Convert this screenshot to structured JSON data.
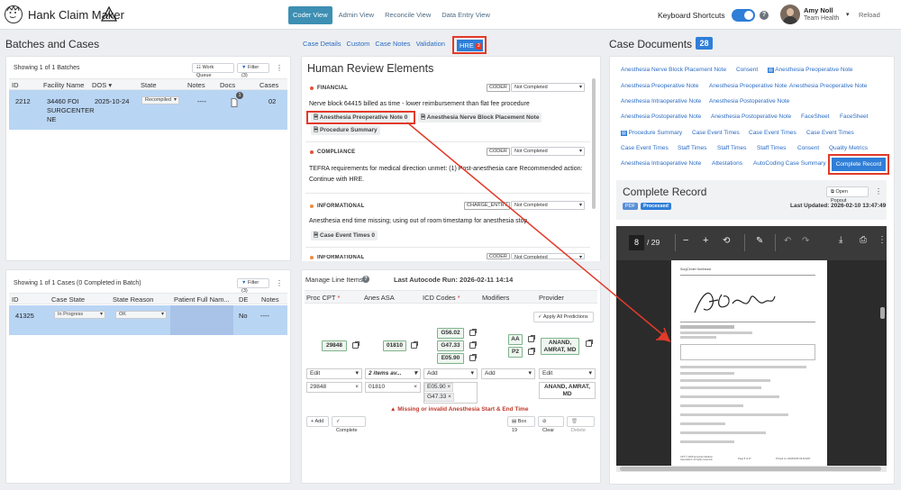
{
  "app": {
    "title": "Hank Claim Maker",
    "nav": [
      "Coder View",
      "Admin View",
      "Reconcile View",
      "Data Entry View"
    ],
    "active_nav": "Coder View"
  },
  "header": {
    "keyboard_shortcuts": "Keyboard Shortcuts",
    "user_name": "Amy Noll",
    "user_org": "Team Health",
    "reload": "Reload"
  },
  "batches": {
    "title": "Batches and Cases",
    "showing": "Showing 1 of 1 Batches",
    "work_queue": "Work Queue",
    "filter": "Filter (3)",
    "columns": [
      "ID",
      "Facility Name",
      "DOS",
      "State",
      "Notes",
      "Docs",
      "Cases"
    ],
    "row": {
      "id": "2212",
      "facility_line1": "34460 FOI",
      "facility_line2": "SURGCENTER",
      "facility_line3": "NE",
      "dos": "2025-10-24",
      "state": "Recompiled",
      "notes": "----",
      "docs_badge": "1",
      "cases": "02"
    }
  },
  "cases": {
    "showing": "Showing 1 of 1 Cases (0 Completed in Batch)",
    "filter": "Filter (3)",
    "columns": [
      "ID",
      "Case State",
      "State Reason",
      "Patient Full Nam...",
      "DE",
      "Notes"
    ],
    "row": {
      "id": "41325",
      "case_state": "In Progress",
      "state_reason": "OK",
      "de": "No",
      "notes": "----"
    }
  },
  "case_tabs": {
    "items": [
      "Case Details",
      "Custom",
      "Case Notes",
      "Validation"
    ],
    "hre": "HRE",
    "hre_count": "2"
  },
  "hre": {
    "title": "Human Review Elements",
    "sections": [
      {
        "label": "FINANCIAL",
        "role": "CODER",
        "status": "Not Completed",
        "text": "Nerve block 64415 billed as time - lower reimbursement than flat fee procedure",
        "chips": [
          "Anesthesia Preoperative Note 0",
          "Anesthesia Nerve Block Placement Note",
          "Procedure Summary"
        ]
      },
      {
        "label": "COMPLIANCE",
        "role": "CODER",
        "status": "Not Completed",
        "text": "TEFRA requirements for medical direction unmet: (1) Post-anesthesia care Recommended action: Continue with HRE."
      },
      {
        "label": "INFORMATIONAL",
        "role": "CHARGE_ENTRY",
        "status": "Not Completed",
        "text": "Anesthesia end time missing; using out of room timestamp for anesthesia stop.",
        "chips": [
          "Case Event Times 0"
        ]
      },
      {
        "label": "INFORMATIONAL",
        "role": "CODER",
        "status": "Not Completed"
      }
    ],
    "colors": {
      "financial": "#e0533a",
      "compliance": "#e0533a",
      "informational": "#f08a3c"
    }
  },
  "line_items": {
    "title": "Manage Line Items",
    "last_run": "Last Autocode Run: 2026-02-11 14:14",
    "columns": [
      "Proc CPT",
      "Anes ASA",
      "ICD Codes",
      "Modifiers",
      "Provider"
    ],
    "apply": "Apply All Predictions",
    "pred": {
      "cpt": "29848",
      "asa": "01810",
      "icd": [
        "G56.02",
        "G47.33",
        "E05.90"
      ],
      "mods": [
        "AA",
        "P2"
      ],
      "provider": "ANAND, AMRAT, MD"
    },
    "edit_row": {
      "cpt": "Edit",
      "asa": "2 items av...",
      "icd": "Add",
      "mod": "Add",
      "prov": "Edit"
    },
    "values": {
      "cpt": "29848",
      "asa": "01810",
      "icd": [
        "E05.90",
        "G47.33"
      ],
      "provider": "ANAND, AMRAT, MD"
    },
    "warning": "Missing or invalid Anesthesia Start & End Time",
    "buttons": {
      "add": "Add",
      "complete": "Complete",
      "box": "Box 19",
      "clear": "Clear",
      "delete": "Delete"
    }
  },
  "docs": {
    "title": "Case Documents",
    "count": "28",
    "links": [
      "Anesthesia Nerve Block Placement Note",
      "Consent",
      "Anesthesia Preoperative Note",
      "Anesthesia Preoperative Note",
      "Anesthesia Preoperative Note",
      "Anesthesia Preoperative Note",
      "Anesthesia Intraoperative Note",
      "Anesthesia Postoperative Note",
      "Anesthesia Postoperative Note",
      "Anesthesia Postoperative Note",
      "FaceSheet",
      "FaceSheet",
      "Procedure Summary",
      "Case Event Times",
      "Case Event Times",
      "Case Event Times",
      "Case Event Times",
      "Staff Times",
      "Staff Times",
      "Staff Times",
      "Consent",
      "Quality Metrics",
      "Anesthesia Intraoperative Note",
      "Attestations",
      "AutoCoding Case Summary",
      "Complete Record"
    ],
    "viewer_title": "Complete Record",
    "open_popout": "Open Popout",
    "badge_pdf": "PDF",
    "badge_processed": "Processed",
    "last_updated": "Last Updated: 2026-02-10 13:47:49",
    "page": "8",
    "pages": "/ 29"
  },
  "pdf_text": {
    "header": "SurgCenter Northeast",
    "footer_left": "CPT © 2025 American Medical Association. All rights reserved.",
    "footer_mid": "Page 8 of 27",
    "footer_right": "Printed on 10/28/2025 09:49 EDT"
  }
}
